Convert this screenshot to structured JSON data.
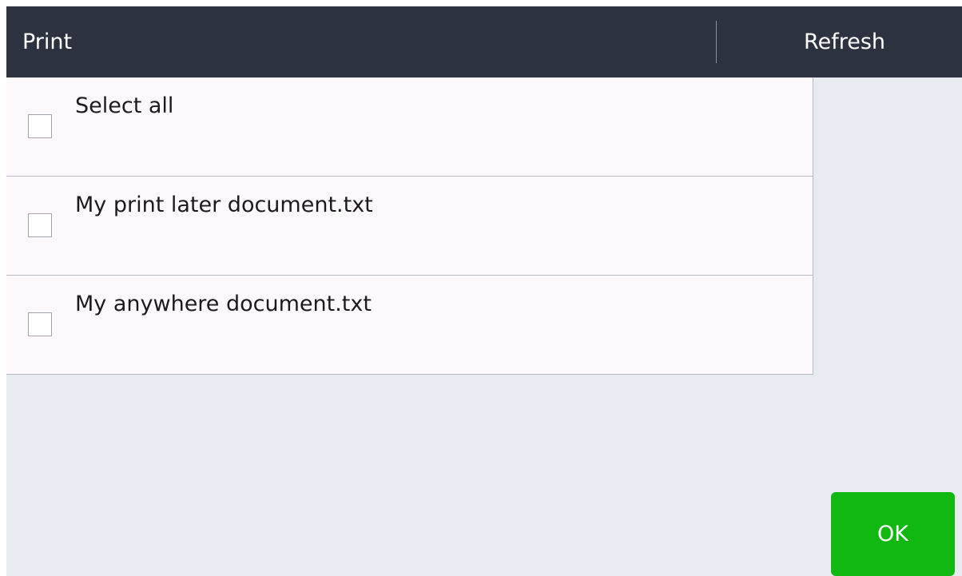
{
  "header": {
    "title": "Print",
    "refresh_label": "Refresh"
  },
  "list": {
    "items": [
      {
        "label": "Select all",
        "checked": false
      },
      {
        "label": "My print later document.txt",
        "checked": false
      },
      {
        "label": "My anywhere document.txt",
        "checked": false
      }
    ]
  },
  "footer": {
    "ok_label": "OK"
  },
  "colors": {
    "header_bg": "#2d3240",
    "screen_bg": "#e9ebf3",
    "list_bg": "#fdf8fc",
    "ok_button": "#12b812"
  }
}
